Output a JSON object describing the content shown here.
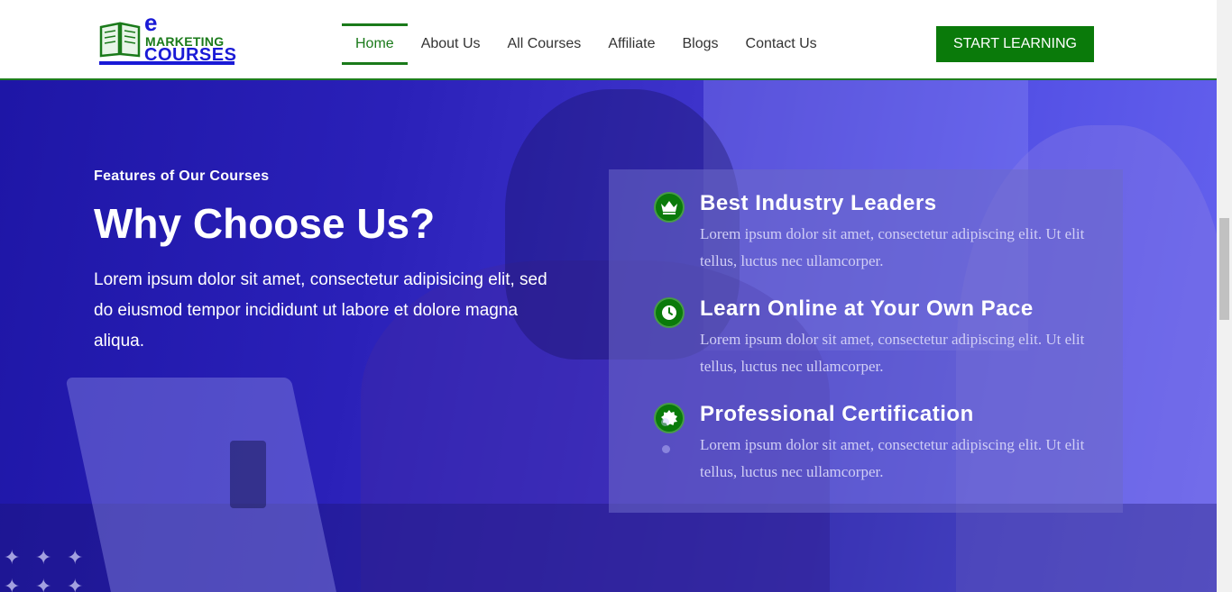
{
  "header": {
    "logo": {
      "line1": "e",
      "line2": "MARKETING",
      "line3": "COURSES"
    },
    "nav": [
      {
        "label": "Home",
        "active": true
      },
      {
        "label": "About Us",
        "active": false
      },
      {
        "label": "All Courses",
        "active": false
      },
      {
        "label": "Affiliate",
        "active": false
      },
      {
        "label": "Blogs",
        "active": false
      },
      {
        "label": "Contact Us",
        "active": false
      }
    ],
    "cta_label": "START LEARNING"
  },
  "hero": {
    "eyebrow": "Features of Our Courses",
    "headline": "Why Choose Us?",
    "lede": "Lorem ipsum dolor sit amet, consectetur adipisicing elit, sed do eiusmod tempor incididunt ut labore et dolore magna aliqua.",
    "features": [
      {
        "icon": "crown-icon",
        "title": "Best Industry Leaders",
        "desc": "Lorem ipsum dolor sit amet, consectetur adipiscing elit. Ut elit tellus, luctus nec ullamcorper."
      },
      {
        "icon": "clock-icon",
        "title": "Learn Online at Your Own Pace",
        "desc": "Lorem ipsum dolor sit amet, consectetur adipiscing elit. Ut elit tellus, luctus nec ullamcorper."
      },
      {
        "icon": "certificate-badge-icon",
        "title": "Professional Certification",
        "desc": "Lorem ipsum dolor sit amet, consectetur adipiscing elit. Ut elit tellus, luctus nec ullamcorper."
      }
    ]
  },
  "colors": {
    "brand_green": "#0a7a0a",
    "brand_blue": "#1a1ad6",
    "hero_overlay": "#2a20b8"
  }
}
